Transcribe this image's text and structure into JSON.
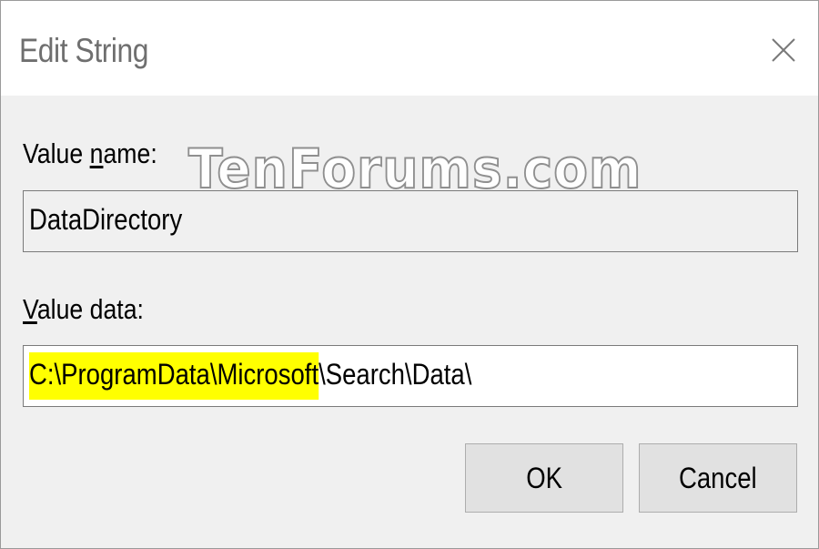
{
  "dialog": {
    "title": "Edit String",
    "close_icon": "close-icon"
  },
  "value_name": {
    "label_mnemonic": "n",
    "label_before": "Value ",
    "label_after": "ame:",
    "value": "DataDirectory"
  },
  "value_data": {
    "label_mnemonic": "V",
    "label_rest": "alue data:",
    "highlighted_part": "C:\\ProgramData\\Microsoft",
    "rest_part": "\\Search\\Data\\",
    "highlight_color": "#ffff00"
  },
  "buttons": {
    "ok_label": "OK",
    "cancel_label": "Cancel"
  },
  "watermark": {
    "text": "TenForums.com"
  }
}
